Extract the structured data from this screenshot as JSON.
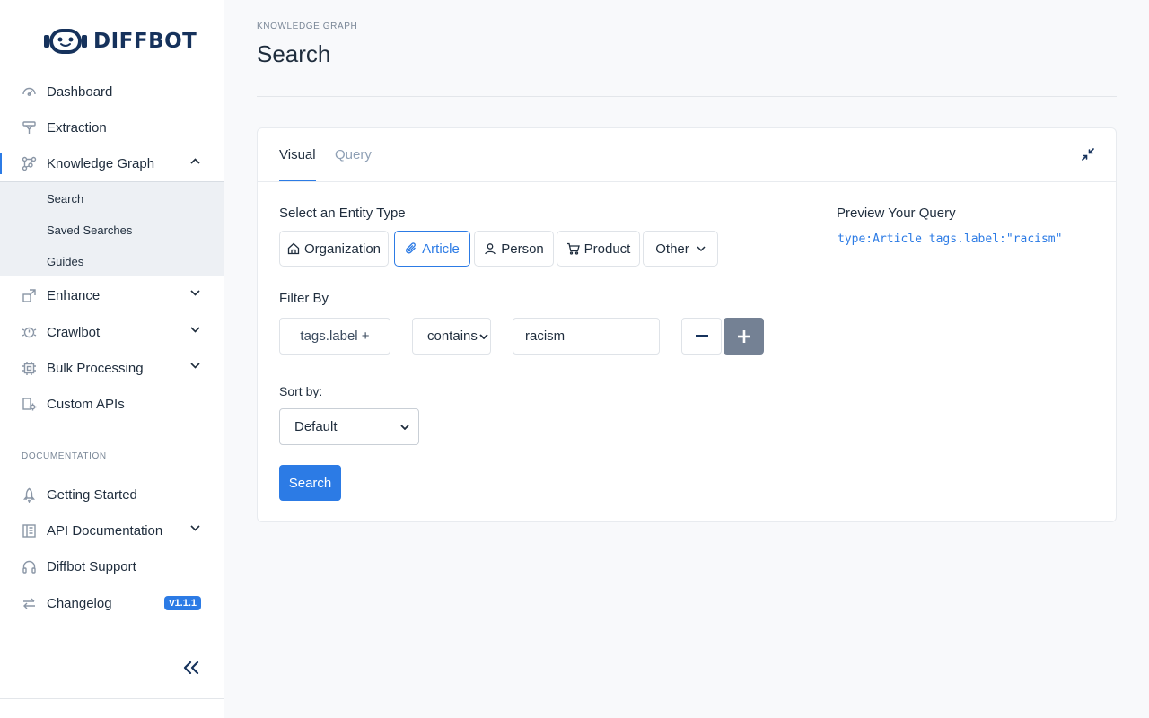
{
  "app": {
    "logo_text": "DIFFBOT"
  },
  "sidebar": {
    "items": [
      {
        "label": "Dashboard",
        "icon": "dashboard-icon"
      },
      {
        "label": "Extraction",
        "icon": "extraction-icon"
      },
      {
        "label": "Knowledge Graph",
        "icon": "knowledge-graph-icon",
        "expanded": true
      },
      {
        "label": "Enhance",
        "icon": "enhance-icon"
      },
      {
        "label": "Crawlbot",
        "icon": "crawlbot-icon"
      },
      {
        "label": "Bulk Processing",
        "icon": "bulk-processing-icon"
      },
      {
        "label": "Custom APIs",
        "icon": "custom-apis-icon"
      }
    ],
    "subitems": [
      {
        "label": "Search"
      },
      {
        "label": "Saved Searches"
      },
      {
        "label": "Guides"
      }
    ],
    "documentation_heading": "DOCUMENTATION",
    "doc_items": [
      {
        "label": "Getting Started",
        "icon": "rocket-icon"
      },
      {
        "label": "API Documentation",
        "icon": "book-icon"
      },
      {
        "label": "Diffbot Support",
        "icon": "headphones-icon"
      },
      {
        "label": "Changelog",
        "icon": "swap-icon",
        "badge": "v1.1.1"
      }
    ]
  },
  "breadcrumb": "KNOWLEDGE GRAPH",
  "page_title": "Search",
  "card": {
    "tabs": [
      {
        "label": "Visual"
      },
      {
        "label": "Query"
      }
    ],
    "entity_type_label": "Select an Entity Type",
    "entity_types": [
      {
        "label": "Organization",
        "icon": "home-icon"
      },
      {
        "label": "Article",
        "icon": "paperclip-icon",
        "selected": true
      },
      {
        "label": "Person",
        "icon": "user-icon"
      },
      {
        "label": "Product",
        "icon": "cart-icon"
      },
      {
        "label": "Other",
        "icon": "chevron-down-icon"
      }
    ],
    "preview_label": "Preview Your Query",
    "preview_query": "type:Article tags.label:\"racism\"",
    "filter_label": "Filter By",
    "filter": {
      "field": "tags.label +",
      "operator": "contains",
      "value": "racism"
    },
    "sort_label": "Sort by:",
    "sort_value": "Default",
    "search_button": "Search"
  },
  "colors": {
    "accent": "#2c7be5",
    "text": "#1f2d3d",
    "muted": "#7a8797",
    "brand": "#16325c"
  }
}
